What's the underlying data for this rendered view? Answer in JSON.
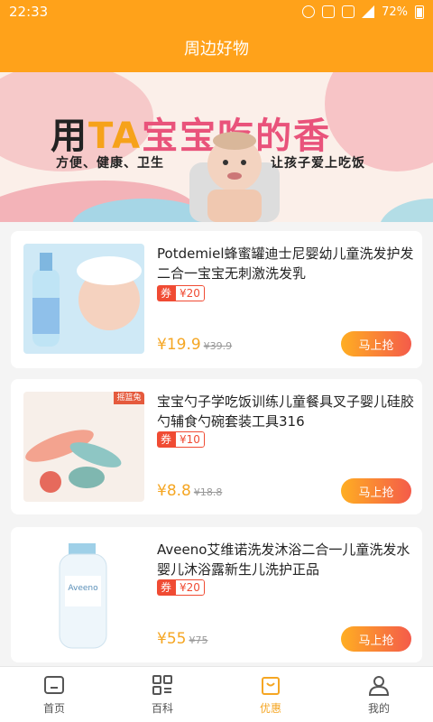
{
  "status_bar": {
    "time": "22:33",
    "battery": "72%"
  },
  "header": {
    "title": "周边好物"
  },
  "banner": {
    "title_part1": "用",
    "title_part2": "TA",
    "title_part3": "宝宝吃的香",
    "subtitle_left": "方便、健康、卫生",
    "subtitle_right": "让孩子爱上吃饭"
  },
  "products": [
    {
      "name": "Potdemiel蜂蜜罐迪士尼婴幼儿童洗发护发二合一宝宝无刺激洗发乳",
      "coupon_label": "券",
      "coupon_value": "¥20",
      "price": "¥19.9",
      "old_price": "¥39.9",
      "buy_label": "马上抢"
    },
    {
      "name": "宝宝勺子学吃饭训练儿童餐具叉子婴儿硅胶勺辅食勺碗套装工具316",
      "coupon_label": "券",
      "coupon_value": "¥10",
      "price": "¥8.8",
      "old_price": "¥18.8",
      "buy_label": "马上抢",
      "thumb_tag": "摇篮兔"
    },
    {
      "name": "Aveeno艾维诺洗发沐浴二合一儿童洗发水婴儿沐浴露新生儿洗护正品",
      "coupon_label": "券",
      "coupon_value": "¥20",
      "price": "¥55",
      "old_price": "¥75",
      "buy_label": "马上抢"
    }
  ],
  "tabs": [
    {
      "label": "首页",
      "icon": "home-icon"
    },
    {
      "label": "百科",
      "icon": "grid-icon"
    },
    {
      "label": "优惠",
      "icon": "bag-icon",
      "active": true
    },
    {
      "label": "我的",
      "icon": "user-icon"
    }
  ],
  "colors": {
    "accent": "#ffa21a",
    "price": "#f5a623",
    "coupon": "#f04b33"
  }
}
